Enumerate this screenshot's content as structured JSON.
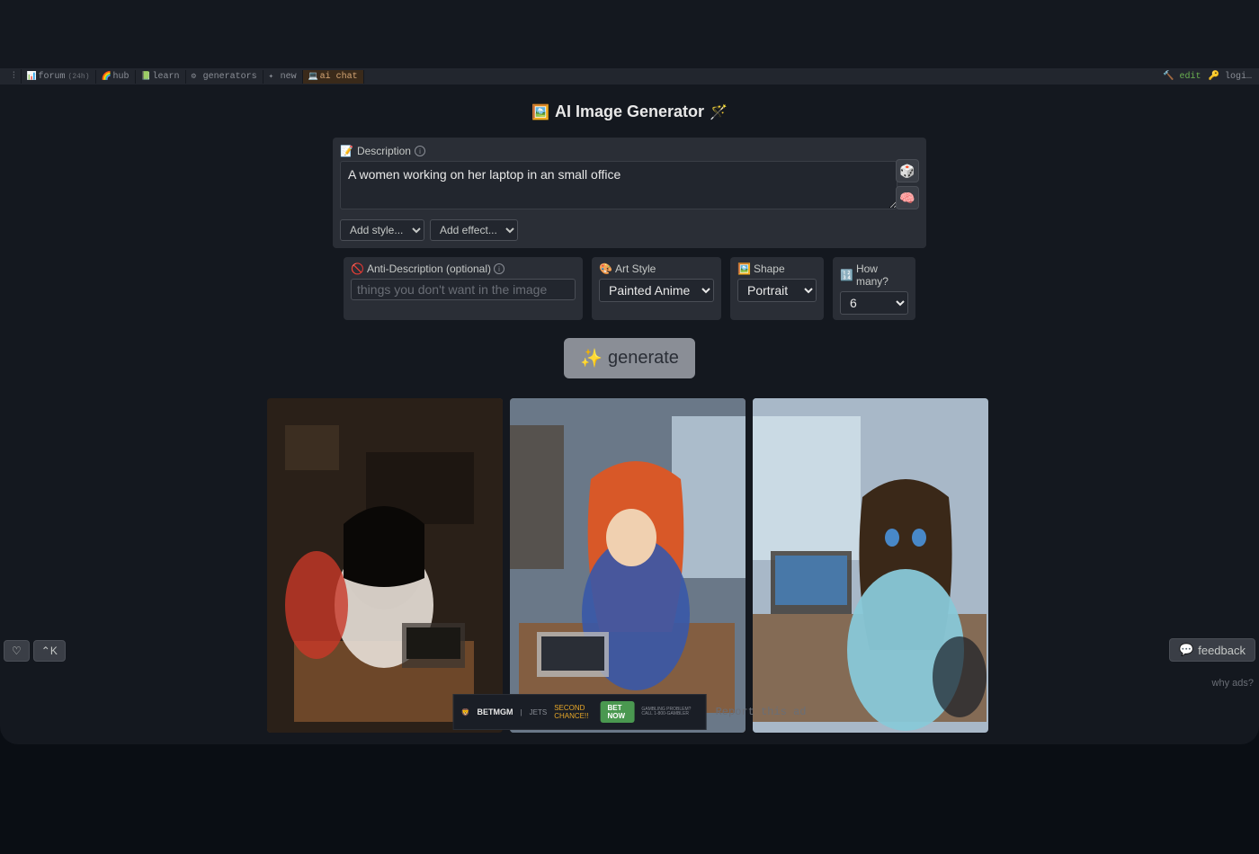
{
  "nav": {
    "items": [
      {
        "icon": "📊",
        "label": "forum",
        "count": "(24h)"
      },
      {
        "icon": "🌈",
        "label": "hub"
      },
      {
        "icon": "📗",
        "label": "learn"
      },
      {
        "icon": "⚙",
        "label": "generators"
      },
      {
        "icon": "✦",
        "label": "new"
      },
      {
        "icon": "💻",
        "label": "ai chat",
        "active": true
      }
    ],
    "edit": "edit",
    "login": "logi…"
  },
  "title": {
    "prefix": "🖼️",
    "text": "AI Image Generator",
    "suffix": "🪄"
  },
  "description": {
    "label_icon": "📝",
    "label": "Description",
    "value": "A women working on her laptop in an small office"
  },
  "side_buttons": {
    "dice": "🎲",
    "brain": "🧠"
  },
  "style_row": {
    "add_style": "Add style...",
    "add_effect": "Add effect..."
  },
  "anti": {
    "icon": "🚫",
    "label": "Anti-Description (optional)",
    "placeholder": "things you don't want in the image"
  },
  "art_style": {
    "icon": "🎨",
    "label": "Art Style",
    "value": "Painted Anime"
  },
  "shape": {
    "icon": "🖼️",
    "label": "Shape",
    "value": "Portrait"
  },
  "how_many": {
    "icon": "🔢",
    "label": "How many?",
    "value": "6"
  },
  "generate": {
    "icon": "✨",
    "label": "generate"
  },
  "bottom_left": {
    "heart": "♡",
    "shortcut": "⌃K"
  },
  "feedback": {
    "icon": "💬",
    "label": "feedback"
  },
  "why_ads": "why ads?",
  "ad": {
    "brand": "BETMGM",
    "sub": "JETS",
    "tagline": "SECOND CHANCE!!",
    "cta": "BET NOW",
    "fine": "GAMBLING PROBLEM? CALL 1-800-GAMBLER"
  },
  "report_ad": "Report this ad"
}
